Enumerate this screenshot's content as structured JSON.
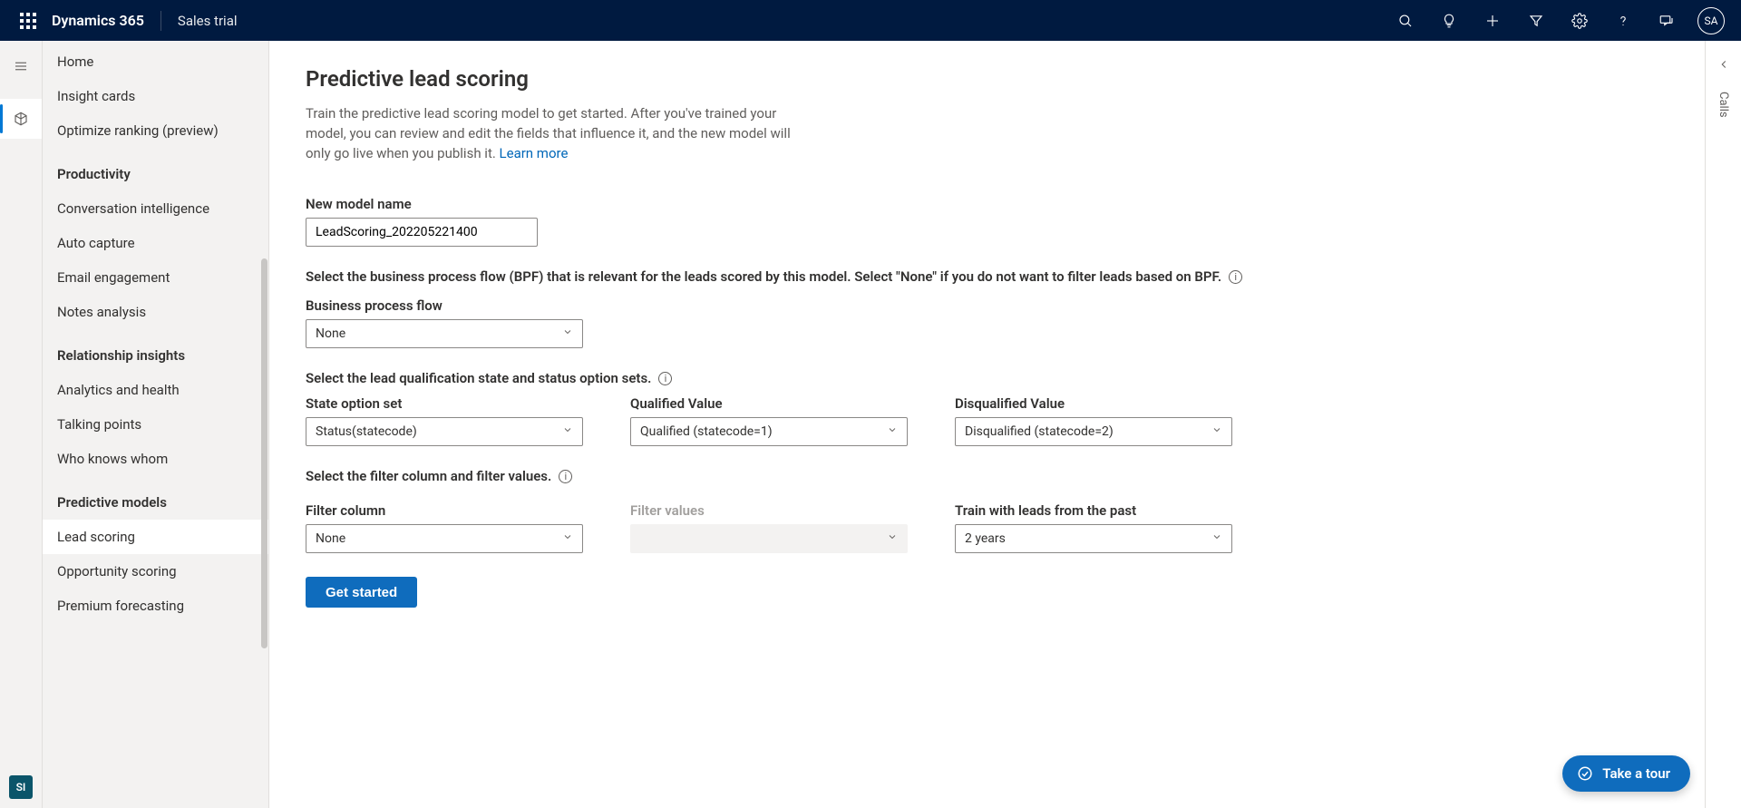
{
  "header": {
    "brand": "Dynamics 365",
    "env": "Sales trial",
    "avatar_initials": "SA"
  },
  "left_rail": {
    "si_badge": "SI"
  },
  "sidenav": {
    "items": [
      {
        "label": "Home",
        "type": "item"
      },
      {
        "label": "Insight cards",
        "type": "item"
      },
      {
        "label": "Optimize ranking (preview)",
        "type": "item"
      },
      {
        "label": "Productivity",
        "type": "group"
      },
      {
        "label": "Conversation intelligence",
        "type": "item"
      },
      {
        "label": "Auto capture",
        "type": "item"
      },
      {
        "label": "Email engagement",
        "type": "item"
      },
      {
        "label": "Notes analysis",
        "type": "item"
      },
      {
        "label": "Relationship insights",
        "type": "group"
      },
      {
        "label": "Analytics and health",
        "type": "item"
      },
      {
        "label": "Talking points",
        "type": "item"
      },
      {
        "label": "Who knows whom",
        "type": "item"
      },
      {
        "label": "Predictive models",
        "type": "group"
      },
      {
        "label": "Lead scoring",
        "type": "item",
        "selected": true
      },
      {
        "label": "Opportunity scoring",
        "type": "item"
      },
      {
        "label": "Premium forecasting",
        "type": "item"
      }
    ]
  },
  "page": {
    "title": "Predictive lead scoring",
    "description": "Train the predictive lead scoring model to get started. After you've trained your model, you can review and edit the fields that influence it, and the new model will only go live when you publish it. ",
    "learn_more": "Learn more",
    "new_model_label": "New model name",
    "new_model_value": "LeadScoring_202205221400",
    "bpf_instruction": "Select the business process flow (BPF) that is relevant for the leads scored by this model. Select \"None\" if you do not want to filter leads based on BPF.",
    "bpf_label": "Business process flow",
    "bpf_value": "None",
    "state_instruction": "Select the lead qualification state and status option sets.",
    "state_option_label": "State option set",
    "state_option_value": "Status(statecode)",
    "qualified_label": "Qualified Value",
    "qualified_value": "Qualified (statecode=1)",
    "disqualified_label": "Disqualified Value",
    "disqualified_value": "Disqualified (statecode=2)",
    "filter_instruction": "Select the filter column and filter values.",
    "filter_column_label": "Filter column",
    "filter_column_value": "None",
    "filter_values_label": "Filter values",
    "filter_values_value": "",
    "train_label": "Train with leads from the past",
    "train_value": "2 years",
    "get_started": "Get started"
  },
  "right_panel": {
    "tab_label": "Calls"
  },
  "fab": {
    "label": "Take a tour"
  }
}
